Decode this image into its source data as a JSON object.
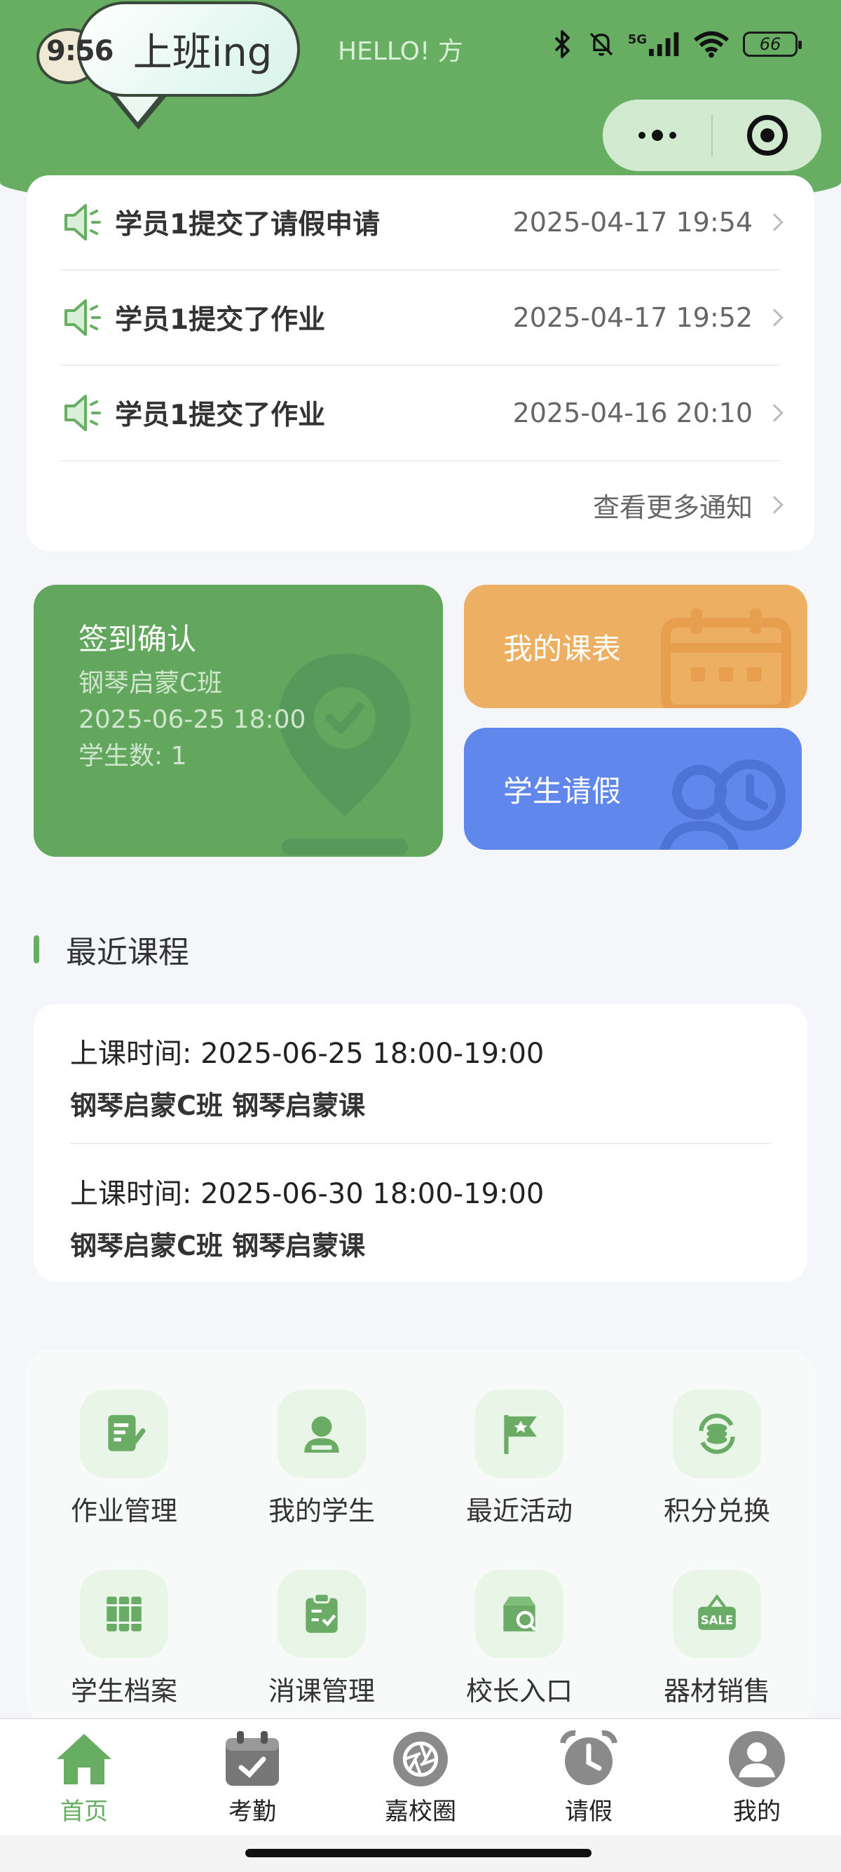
{
  "status_bar": {
    "time": "9:56",
    "battery": "66",
    "signal_label": "5G"
  },
  "header": {
    "bubble_text": "上班ing",
    "greeting": "HELLO! 方"
  },
  "notices": {
    "items": [
      {
        "title": "学员1提交了请假申请",
        "time": "2025-04-17 19:54"
      },
      {
        "title": "学员1提交了作业",
        "time": "2025-04-17 19:52"
      },
      {
        "title": "学员1提交了作业",
        "time": "2025-04-16 20:10"
      }
    ],
    "more_label": "查看更多通知"
  },
  "signin": {
    "title": "签到确认",
    "class_name": "钢琴启蒙C班",
    "datetime": "2025-06-25 18:00",
    "students": "学生数: 1"
  },
  "schedule": {
    "label": "我的课表"
  },
  "leave": {
    "label": "学生请假"
  },
  "recent": {
    "title": "最近课程",
    "courses": [
      {
        "time": "上课时间: 2025-06-25 18:00-19:00",
        "name": "钢琴启蒙C班 钢琴启蒙课"
      },
      {
        "time": "上课时间: 2025-06-30 18:00-19:00",
        "name": "钢琴启蒙C班 钢琴启蒙课"
      }
    ]
  },
  "menu": {
    "items": [
      {
        "label": "作业管理",
        "icon": "homework-edit-icon"
      },
      {
        "label": "我的学生",
        "icon": "student-person-icon"
      },
      {
        "label": "最近活动",
        "icon": "flag-icon"
      },
      {
        "label": "积分兑换",
        "icon": "points-exchange-icon"
      },
      {
        "label": "学生档案",
        "icon": "archive-binders-icon"
      },
      {
        "label": "消课管理",
        "icon": "clipboard-check-icon"
      },
      {
        "label": "校长入口",
        "icon": "principal-box-icon"
      },
      {
        "label": "器材销售",
        "icon": "sale-tag-icon"
      }
    ]
  },
  "tabbar": {
    "items": [
      {
        "label": "首页",
        "icon": "home-icon",
        "active": true
      },
      {
        "label": "考勤",
        "icon": "calendar-check-icon",
        "active": false
      },
      {
        "label": "嘉校圈",
        "icon": "aperture-icon",
        "active": false
      },
      {
        "label": "请假",
        "icon": "alarm-clock-icon",
        "active": false
      },
      {
        "label": "我的",
        "icon": "user-icon",
        "active": false
      }
    ]
  },
  "colors": {
    "primary": "#67ae63",
    "signin_card": "#63a75f",
    "schedule_card": "#edb062",
    "leave_card": "#5f87ec",
    "background": "#f4f6fa"
  }
}
